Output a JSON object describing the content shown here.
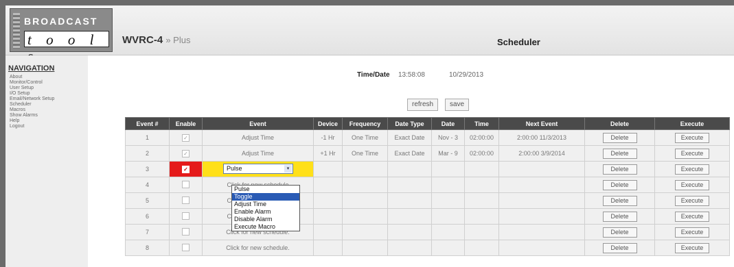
{
  "header": {
    "logo_top": "BROADCAST",
    "logo_bottom": "t o o l s",
    "product_name": "WVRC-4",
    "product_suffix": "» Plus",
    "page_title": "Scheduler"
  },
  "navigation": {
    "title": "NAVIGATION",
    "items": [
      "About",
      "Monitor/Control",
      "User Setup",
      "I/O Setup",
      "Email/Network Setup",
      "Scheduler",
      "Macros",
      "Show Alarms",
      "Help",
      "Logout"
    ]
  },
  "time_date": {
    "label": "Time/Date",
    "time": "13:58:08",
    "date": "10/29/2013"
  },
  "buttons": {
    "refresh": "refresh",
    "save": "save"
  },
  "table": {
    "headers": [
      "Event #",
      "Enable",
      "Event",
      "Device",
      "Frequency",
      "Date Type",
      "Date",
      "Time",
      "Next Event",
      "Delete",
      "Execute"
    ],
    "delete_label": "Delete",
    "execute_label": "Execute",
    "rows": [
      {
        "num": "1",
        "enabled": "☑",
        "event": "Adjust Time",
        "device": "-1 Hr",
        "frequency": "One Time",
        "date_type": "Exact Date",
        "date": "Nov - 3",
        "time": "02:00:00",
        "next": "2:00:00 11/3/2013"
      },
      {
        "num": "2",
        "enabled": "☑",
        "event": "Adjust Time",
        "device": "+1 Hr",
        "frequency": "One Time",
        "date_type": "Exact Date",
        "date": "Mar - 9",
        "time": "02:00:00",
        "next": "2:00:00 3/9/2014"
      },
      {
        "num": "3",
        "enabled": "✓",
        "event": "Pulse",
        "device": "",
        "frequency": "",
        "date_type": "",
        "date": "",
        "time": "",
        "next": ""
      },
      {
        "num": "4",
        "enabled": "",
        "event": "Click for new schedule",
        "device": "",
        "frequency": "",
        "date_type": "",
        "date": "",
        "time": "",
        "next": ""
      },
      {
        "num": "5",
        "enabled": "",
        "event": "Click for new schedule",
        "device": "",
        "frequency": "",
        "date_type": "",
        "date": "",
        "time": "",
        "next": ""
      },
      {
        "num": "6",
        "enabled": "",
        "event": "Click for new schedule",
        "device": "",
        "frequency": "",
        "date_type": "",
        "date": "",
        "time": "",
        "next": ""
      },
      {
        "num": "7",
        "enabled": "",
        "event": "Click for new schedule.",
        "device": "",
        "frequency": "",
        "date_type": "",
        "date": "",
        "time": "",
        "next": ""
      },
      {
        "num": "8",
        "enabled": "",
        "event": "Click for new schedule.",
        "device": "",
        "frequency": "",
        "date_type": "",
        "date": "",
        "time": "",
        "next": ""
      }
    ]
  },
  "event_dropdown": {
    "selected_value": "Pulse",
    "options": [
      "Pulse",
      "Toggle",
      "Adjust Time",
      "Enable Alarm",
      "Disable Alarm",
      "Execute Macro"
    ],
    "highlighted": "Toggle"
  },
  "colors": {
    "enable_active": "#e51b1b",
    "event_active": "#ffe01a",
    "highlight": "#2a5bb5",
    "table_header": "#4a4a4a"
  }
}
